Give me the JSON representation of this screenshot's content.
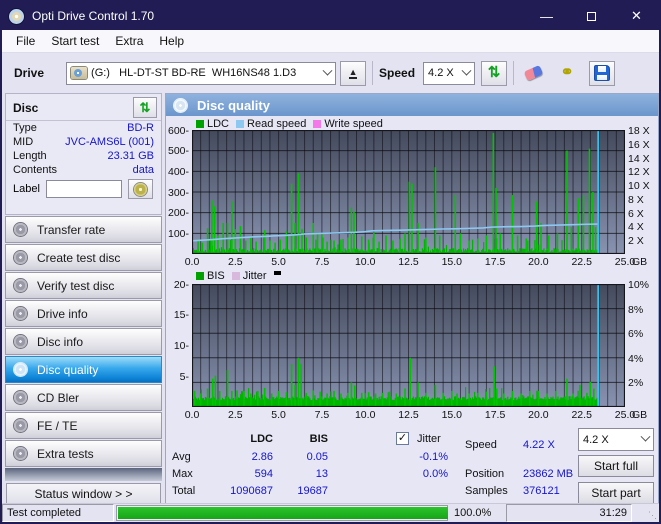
{
  "window": {
    "title": "Opti Drive Control 1.70"
  },
  "menu": {
    "items": [
      "File",
      "Start test",
      "Extra",
      "Help"
    ]
  },
  "toolbar": {
    "drive_label": "Drive",
    "drive_value": "(G:)   HL-DT-ST BD-RE  WH16NS48 1.D3",
    "speed_label": "Speed",
    "speed_value": "4.2 X"
  },
  "disc_panel": {
    "title": "Disc",
    "rows": [
      {
        "label": "Type",
        "value": "BD-R"
      },
      {
        "label": "MID",
        "value": "JVC-AMS6L (001)"
      },
      {
        "label": "Length",
        "value": "23.31 GB"
      },
      {
        "label": "Contents",
        "value": "data"
      }
    ],
    "label_row": {
      "label": "Label",
      "input_value": ""
    }
  },
  "sidebar": {
    "items": [
      {
        "label": "Transfer rate",
        "selected": false
      },
      {
        "label": "Create test disc",
        "selected": false
      },
      {
        "label": "Verify test disc",
        "selected": false
      },
      {
        "label": "Drive info",
        "selected": false
      },
      {
        "label": "Disc info",
        "selected": false
      },
      {
        "label": "Disc quality",
        "selected": true
      },
      {
        "label": "CD Bler",
        "selected": false
      },
      {
        "label": "FE / TE",
        "selected": false
      },
      {
        "label": "Extra tests",
        "selected": false
      }
    ],
    "status_window_label": "Status window > >"
  },
  "panel": {
    "title": "Disc quality"
  },
  "stats": {
    "col_headers": [
      "LDC",
      "BIS"
    ],
    "jitter_label": "Jitter",
    "jitter_checked": true,
    "rows": [
      {
        "label": "Avg",
        "ldc": "2.86",
        "bis": "0.05",
        "jitter": "-0.1%"
      },
      {
        "label": "Max",
        "ldc": "594",
        "bis": "13",
        "jitter": "0.0%"
      },
      {
        "label": "Total",
        "ldc": "1090687",
        "bis": "19687",
        "jitter": ""
      }
    ],
    "right": [
      {
        "label": "Speed",
        "value": "4.22 X"
      },
      {
        "label": "Position",
        "value": "23862 MB"
      },
      {
        "label": "Samples",
        "value": "376121"
      }
    ],
    "speed_select": "4.2 X",
    "start_full": "Start full",
    "start_part": "Start part"
  },
  "statusbar": {
    "text": "Test completed",
    "progress_pct": "100.0%",
    "progress_value": 100,
    "time": "31:29"
  },
  "colors": {
    "accent_navy": "#211d54",
    "value_blue": "#1515cc",
    "ldc_green": "#00b400",
    "read_speed_blue": "#8cc8f0",
    "write_speed_pink": "#f478e8",
    "jitter_pink": "#d8b8dc",
    "end_line_cyan": "#38c8f8",
    "progress_green": "#1cb81c"
  },
  "chart_data": [
    {
      "type": "bar",
      "name": "LDC errors vs read speed",
      "legend": [
        {
          "label": "LDC",
          "color": "#00a000"
        },
        {
          "label": "Read speed",
          "color": "#8cc8f0"
        },
        {
          "label": "Write speed",
          "color": "#f478e8"
        }
      ],
      "xlim": [
        0,
        25
      ],
      "x_unit": "GB",
      "x_grid_step": 0.5,
      "x_end": 23.42,
      "x_ticks": [
        "0.0",
        "2.5",
        "5.0",
        "7.5",
        "10.0",
        "12.5",
        "15.0",
        "17.5",
        "20.0",
        "22.5",
        "25.0"
      ],
      "left_axis": {
        "max": 600,
        "ticks": [
          600,
          500,
          400,
          300,
          200,
          100
        ],
        "grid_divs": 6
      },
      "right_axis": {
        "max": 18,
        "ticks": [
          {
            "v": 18,
            "t": "18 X"
          },
          {
            "v": 16,
            "t": "16 X"
          },
          {
            "v": 14,
            "t": "14 X"
          },
          {
            "v": 12,
            "t": "12 X"
          },
          {
            "v": 10,
            "t": "10 X"
          },
          {
            "v": 8,
            "t": "8 X"
          },
          {
            "v": 6,
            "t": "6 X"
          },
          {
            "v": 4,
            "t": "4 X"
          },
          {
            "v": 2,
            "t": "2 X"
          }
        ]
      },
      "baseline": {
        "solid": 9,
        "spread": 36,
        "big_chance": 0.1,
        "big_mul": 2.0
      },
      "noise_seed": 7,
      "spikes": [
        [
          0.35,
          70
        ],
        [
          0.6,
          55
        ],
        [
          0.9,
          125
        ],
        [
          1.15,
          260
        ],
        [
          1.3,
          230
        ],
        [
          1.5,
          90
        ],
        [
          1.8,
          150
        ],
        [
          2.05,
          150
        ],
        [
          2.3,
          255
        ],
        [
          2.5,
          120
        ],
        [
          2.8,
          135
        ],
        [
          3.1,
          65
        ],
        [
          3.4,
          80
        ],
        [
          3.7,
          60
        ],
        [
          4.2,
          115
        ],
        [
          4.5,
          65
        ],
        [
          4.8,
          55
        ],
        [
          5.1,
          70
        ],
        [
          5.45,
          110
        ],
        [
          5.75,
          340
        ],
        [
          5.95,
          150
        ],
        [
          6.15,
          390
        ],
        [
          6.35,
          120
        ],
        [
          6.6,
          80
        ],
        [
          7.0,
          150
        ],
        [
          7.25,
          105
        ],
        [
          7.5,
          95
        ],
        [
          7.8,
          60
        ],
        [
          8.2,
          65
        ],
        [
          8.6,
          70
        ],
        [
          9.0,
          80
        ],
        [
          9.2,
          225
        ],
        [
          9.35,
          205
        ],
        [
          9.8,
          85
        ],
        [
          10.2,
          70
        ],
        [
          10.5,
          105
        ],
        [
          10.8,
          60
        ],
        [
          11.2,
          90
        ],
        [
          11.6,
          65
        ],
        [
          12.0,
          70
        ],
        [
          12.3,
          100
        ],
        [
          12.55,
          350
        ],
        [
          12.7,
          340
        ],
        [
          13.05,
          150
        ],
        [
          13.5,
          80
        ],
        [
          14.05,
          420
        ],
        [
          14.3,
          90
        ],
        [
          15.2,
          285
        ],
        [
          15.5,
          100
        ],
        [
          16.0,
          65
        ],
        [
          16.5,
          75
        ],
        [
          17.0,
          90
        ],
        [
          17.4,
          585
        ],
        [
          17.55,
          320
        ],
        [
          17.8,
          100
        ],
        [
          18.5,
          285
        ],
        [
          18.8,
          90
        ],
        [
          19.3,
          75
        ],
        [
          19.9,
          255
        ],
        [
          20.15,
          150
        ],
        [
          20.6,
          90
        ],
        [
          21.1,
          100
        ],
        [
          21.65,
          500
        ],
        [
          21.9,
          130
        ],
        [
          22.3,
          270
        ],
        [
          22.6,
          285
        ],
        [
          22.95,
          510
        ],
        [
          23.15,
          300
        ],
        [
          23.3,
          130
        ]
      ],
      "line": {
        "name": "Read speed",
        "color": "#8cc8f0",
        "points": [
          [
            0,
            64
          ],
          [
            0.6,
            67
          ],
          [
            1.2,
            70
          ],
          [
            1.8,
            74
          ],
          [
            2.4,
            77
          ],
          [
            3,
            80
          ],
          [
            3.6,
            83
          ],
          [
            4.2,
            85
          ],
          [
            4.8,
            88
          ],
          [
            5.4,
            90
          ],
          [
            6,
            93
          ],
          [
            6.5,
            97
          ],
          [
            7.2,
            99
          ],
          [
            8,
            101
          ],
          [
            8.7,
            103
          ],
          [
            9.4,
            105
          ],
          [
            10,
            108
          ],
          [
            10.4,
            112
          ],
          [
            11.2,
            114
          ],
          [
            12,
            115
          ],
          [
            12.8,
            117
          ],
          [
            13.6,
            119
          ],
          [
            14.4,
            121
          ],
          [
            15.2,
            122
          ],
          [
            16,
            124
          ],
          [
            16.8,
            126
          ],
          [
            17.3,
            130
          ],
          [
            18.2,
            132
          ],
          [
            19,
            133
          ],
          [
            19.8,
            135
          ],
          [
            20.4,
            138
          ],
          [
            21.2,
            140
          ],
          [
            22,
            142
          ],
          [
            22.8,
            144
          ],
          [
            23.42,
            145
          ]
        ]
      },
      "end_line": {
        "x": 23.45,
        "color": "#38c8f8"
      }
    },
    {
      "type": "bar",
      "name": "BIS errors and jitter",
      "legend": [
        {
          "label": "BIS",
          "color": "#00a000"
        },
        {
          "label": "Jitter",
          "color": "#d8b8dc"
        }
      ],
      "legend_marker": "#000000",
      "xlim": [
        0,
        25
      ],
      "x_unit": "GB",
      "x_grid_step": 0.5,
      "x_end": 23.42,
      "x_ticks": [
        "0.0",
        "2.5",
        "5.0",
        "7.5",
        "10.0",
        "12.5",
        "15.0",
        "17.5",
        "20.0",
        "22.5",
        "25.0"
      ],
      "left_axis": {
        "max": 20,
        "ticks": [
          20,
          15,
          10,
          5
        ],
        "grid_divs": 5
      },
      "right_axis": {
        "max": 10,
        "ticks": [
          {
            "v": 10,
            "t": "10%"
          },
          {
            "v": 8,
            "t": "8%"
          },
          {
            "v": 6,
            "t": "6%"
          },
          {
            "v": 4,
            "t": "4%"
          },
          {
            "v": 2,
            "t": "2%"
          }
        ]
      },
      "baseline": {
        "solid": 1.1,
        "spread": 1.2,
        "big_chance": 0.1,
        "big_mul": 1.8
      },
      "noise_seed": 21,
      "spikes": [
        [
          0.15,
          2.6
        ],
        [
          0.5,
          2.2
        ],
        [
          0.9,
          3.0
        ],
        [
          1.2,
          4.6
        ],
        [
          1.35,
          5.1
        ],
        [
          1.6,
          2.6
        ],
        [
          2.05,
          6.0
        ],
        [
          2.3,
          2.6
        ],
        [
          2.6,
          2.7
        ],
        [
          3.0,
          2.6
        ],
        [
          3.4,
          2.2
        ],
        [
          3.8,
          2.6
        ],
        [
          4.2,
          3.1
        ],
        [
          4.6,
          2.2
        ],
        [
          5.0,
          2.6
        ],
        [
          5.45,
          2.4
        ],
        [
          5.75,
          7.0
        ],
        [
          5.95,
          3.6
        ],
        [
          6.15,
          8.0
        ],
        [
          6.3,
          7.0
        ],
        [
          6.6,
          2.3
        ],
        [
          7.0,
          2.7
        ],
        [
          7.4,
          2.5
        ],
        [
          7.8,
          2.2
        ],
        [
          8.2,
          2.6
        ],
        [
          8.6,
          2.2
        ],
        [
          9.0,
          2.3
        ],
        [
          9.2,
          4.0
        ],
        [
          9.4,
          3.5
        ],
        [
          9.8,
          2.3
        ],
        [
          10.2,
          2.4
        ],
        [
          10.6,
          2.2
        ],
        [
          11.0,
          2.3
        ],
        [
          11.4,
          2.5
        ],
        [
          11.8,
          2.2
        ],
        [
          12.3,
          3.0
        ],
        [
          12.6,
          8.0
        ],
        [
          13.05,
          4.0
        ],
        [
          13.5,
          2.3
        ],
        [
          14.05,
          3.6
        ],
        [
          14.5,
          2.3
        ],
        [
          15.0,
          2.6
        ],
        [
          15.3,
          2.2
        ],
        [
          16.0,
          2.2
        ],
        [
          16.5,
          2.3
        ],
        [
          17.0,
          2.5
        ],
        [
          17.45,
          6.6
        ],
        [
          17.6,
          3.0
        ],
        [
          18.0,
          2.2
        ],
        [
          18.5,
          2.6
        ],
        [
          19.0,
          2.2
        ],
        [
          19.5,
          2.6
        ],
        [
          20.0,
          2.6
        ],
        [
          20.5,
          2.2
        ],
        [
          21.0,
          2.6
        ],
        [
          21.65,
          4.6
        ],
        [
          22.0,
          2.2
        ],
        [
          22.4,
          3.6
        ],
        [
          22.8,
          2.3
        ],
        [
          23.0,
          4.1
        ],
        [
          23.2,
          3.0
        ]
      ],
      "end_line": {
        "x": 23.45,
        "color": "#38c8f8"
      }
    }
  ]
}
